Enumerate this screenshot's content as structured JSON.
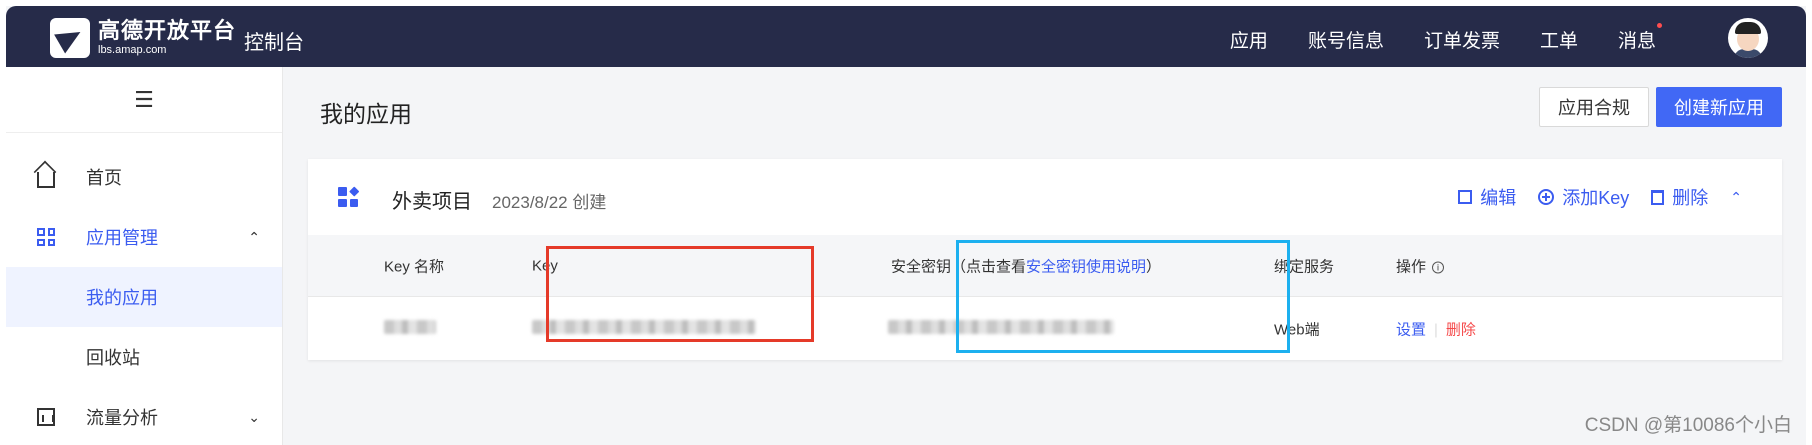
{
  "header": {
    "logo_cn": "高德开放平台",
    "logo_en": "lbs.amap.com",
    "console": "控制台",
    "nav": [
      "应用",
      "账号信息",
      "订单发票",
      "工单",
      "消息"
    ]
  },
  "sidebar": {
    "toggle": "☰",
    "items": [
      {
        "label": "首页",
        "icon": "home-icon"
      },
      {
        "label": "应用管理",
        "icon": "grid-icon",
        "chevron": "⌃"
      },
      {
        "label": "我的应用"
      },
      {
        "label": "回收站"
      },
      {
        "label": "流量分析",
        "icon": "chart-icon",
        "chevron": "⌄"
      }
    ]
  },
  "main": {
    "title": "我的应用",
    "compliance_btn": "应用合规",
    "create_btn": "创建新应用"
  },
  "card": {
    "app_name": "外卖项目",
    "created": "2023/8/22 创建",
    "edit": "编辑",
    "add_key": "添加Key",
    "delete": "删除",
    "collapse": "⌃"
  },
  "table": {
    "headers": {
      "key_name": "Key 名称",
      "key": "Key",
      "secret_prefix": "安全密钥（点击查看",
      "secret_link": "安全密钥使用说明",
      "secret_suffix": "）",
      "service": "绑定服务",
      "ops": "操作"
    },
    "row": {
      "service": "Web端",
      "op_set": "设置",
      "op_delete": "删除"
    }
  },
  "colors": {
    "topbar": "#262b49",
    "primary": "#4168f5",
    "danger": "#f5494a",
    "highlight_red": "#e53a29",
    "highlight_blue": "#1cb0ef"
  },
  "watermark": "CSDN @第10086个小白"
}
